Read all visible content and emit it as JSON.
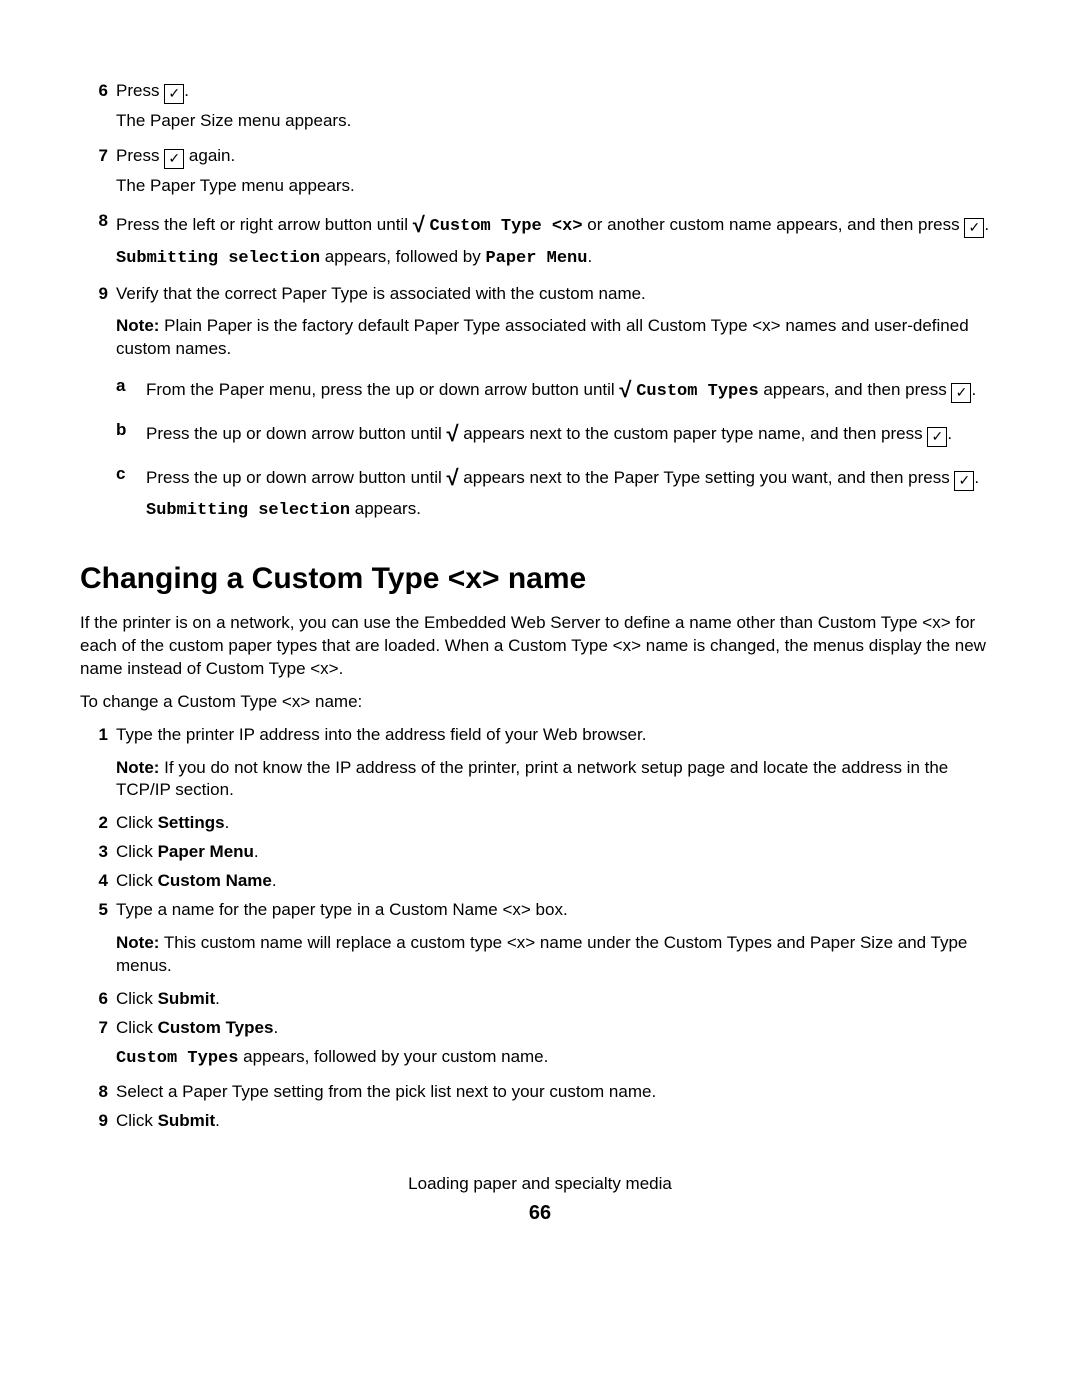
{
  "steps_top": {
    "6": {
      "text_pre": "Press ",
      "text_post": ".",
      "result": "The Paper Size menu appears."
    },
    "7": {
      "text_pre": "Press ",
      "text_post": " again.",
      "result": "The Paper Type menu appears."
    },
    "8": {
      "line_a": "Press the left or right arrow button until ",
      "mono_a": "Custom Type <x>",
      "line_b": " or another custom name appears, and then press ",
      "result_pre": "Submitting selection",
      "result_mid": " appears, followed by ",
      "result_mono": "Paper Menu",
      "result_post": "."
    },
    "9": {
      "text": "Verify that the correct Paper Type is associated with the custom name.",
      "note_label": "Note:",
      "note_text": " Plain Paper is the factory default Paper Type associated with all Custom Type <x> names and user-defined custom names.",
      "sub": {
        "a": {
          "pre": "From the Paper menu, press the up or down arrow button until ",
          "mono": "Custom Types",
          "post": " appears, and then press "
        },
        "b": {
          "pre": "Press the up or down arrow button until ",
          "post": " appears next to the custom paper type name, and then press "
        },
        "c": {
          "pre": "Press the up or down arrow button until ",
          "post": " appears next to the Paper Type setting you want, and then press ",
          "result_mono": "Submitting selection",
          "result_post": " appears."
        }
      }
    }
  },
  "section_heading": "Changing a Custom Type <x> name",
  "section_intro": "If the printer is on a network, you can use the Embedded Web Server to define a name other than Custom Type <x> for each of the custom paper types that are loaded. When a Custom Type <x> name is changed, the menus display the new name instead of Custom Type <x>.",
  "section_lead": "To change a Custom Type <x> name:",
  "steps_bottom": {
    "1": {
      "text": "Type the printer IP address into the address field of your Web browser.",
      "note_label": "Note:",
      "note_text": " If you do not know the IP address of the printer, print a network setup page and locate the address in the TCP/IP section."
    },
    "2": {
      "pre": "Click ",
      "bold": "Settings",
      "post": "."
    },
    "3": {
      "pre": "Click ",
      "bold": "Paper Menu",
      "post": "."
    },
    "4": {
      "pre": "Click ",
      "bold": "Custom Name",
      "post": "."
    },
    "5": {
      "text": "Type a name for the paper type in a Custom Name <x> box.",
      "note_label": "Note:",
      "note_text": " This custom name will replace a custom type <x> name under the Custom Types and Paper Size and Type menus."
    },
    "6": {
      "pre": "Click ",
      "bold": "Submit",
      "post": "."
    },
    "7": {
      "pre": "Click ",
      "bold": "Custom Types",
      "post": ".",
      "result_mono": "Custom Types",
      "result_post": " appears, followed by your custom name."
    },
    "8": {
      "text": "Select a Paper Type setting from the pick list next to your custom name."
    },
    "9": {
      "pre": "Click ",
      "bold": "Submit",
      "post": "."
    }
  },
  "footer": {
    "title": "Loading paper and specialty media",
    "page": "66"
  }
}
